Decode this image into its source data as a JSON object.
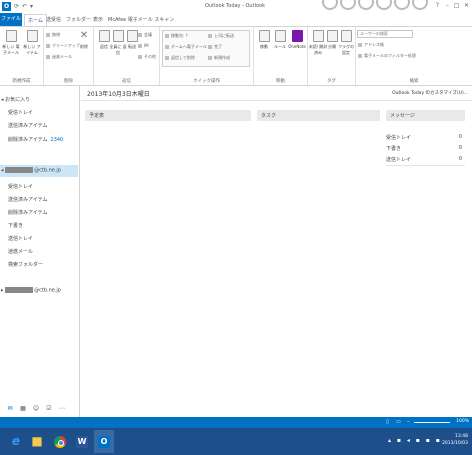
{
  "titlebar": {
    "app_icon": "O",
    "window_title": "Outlook Today - Outlook",
    "controls": [
      "?",
      "–",
      "□",
      "✕"
    ]
  },
  "tabs": {
    "file": "ファイル",
    "items": [
      "ホーム",
      "送受信",
      "フォルダー",
      "表示",
      "McAfee 電子メール スキャン"
    ]
  },
  "ribbon": {
    "groups": [
      "新規作成",
      "削除",
      "返信",
      "クイック操作",
      "移動",
      "タグ",
      "検索"
    ],
    "new_mail": "新しい 電子メール",
    "new_items": "新しい アイテム",
    "ignore": "無視",
    "cleanup": "クリーンアップ",
    "junk": "迷惑メール",
    "delete": "削除",
    "reply": "返信",
    "reply_all": "全員に 返信",
    "forward": "転送",
    "meeting": "会議",
    "im": "IM",
    "other": "その他",
    "qs_items": [
      "移動先: ?",
      "チームへ電子メール",
      "返信して削除",
      "上司に転送",
      "完了",
      "新規作成"
    ],
    "move": "移動",
    "rules": "ルール",
    "onenote": "OneNote",
    "unread": "未読/ 開封済み",
    "categorize": "分類",
    "followup": "フラグの 設定",
    "search_placeholder": "ユーザーの検索",
    "address_book": "アドレス帳",
    "filter_email": "電子メールのフィルター処理"
  },
  "nav": {
    "favorites_header": "お気に入り",
    "favorites": [
      {
        "label": "受信トレイ",
        "count": ""
      },
      {
        "label": "送信済みアイテム",
        "count": ""
      },
      {
        "label": "削除済みアイテム",
        "count": "2340"
      }
    ],
    "account1_suffix": "@ctb.ne.jp",
    "account1_folders": [
      "受信トレイ",
      "送信済みアイテム",
      "削除済みアイテム",
      "下書き",
      "送信トレイ",
      "迷惑メール",
      "検索フォルダー"
    ],
    "account2_suffix": "@ctb.ne.jp"
  },
  "main": {
    "date": "2013年10月3日木曜日",
    "customize": "Outlook Today のカスタマイズ(U)...",
    "calendar_header": "予定表",
    "tasks_header": "タスク",
    "messages_header": "メッセージ",
    "messages": [
      {
        "label": "受信トレイ",
        "value": "0"
      },
      {
        "label": "下書き",
        "value": "0"
      },
      {
        "label": "送信トレイ",
        "value": "0"
      }
    ]
  },
  "status": {
    "zoom": "100%"
  },
  "taskbar": {
    "clock_time": "13:48",
    "clock_date": "2013/10/03"
  },
  "colors": {
    "accent": "#0072c6",
    "taskbar": "#1d4f8a",
    "selection": "#cde6f7"
  }
}
